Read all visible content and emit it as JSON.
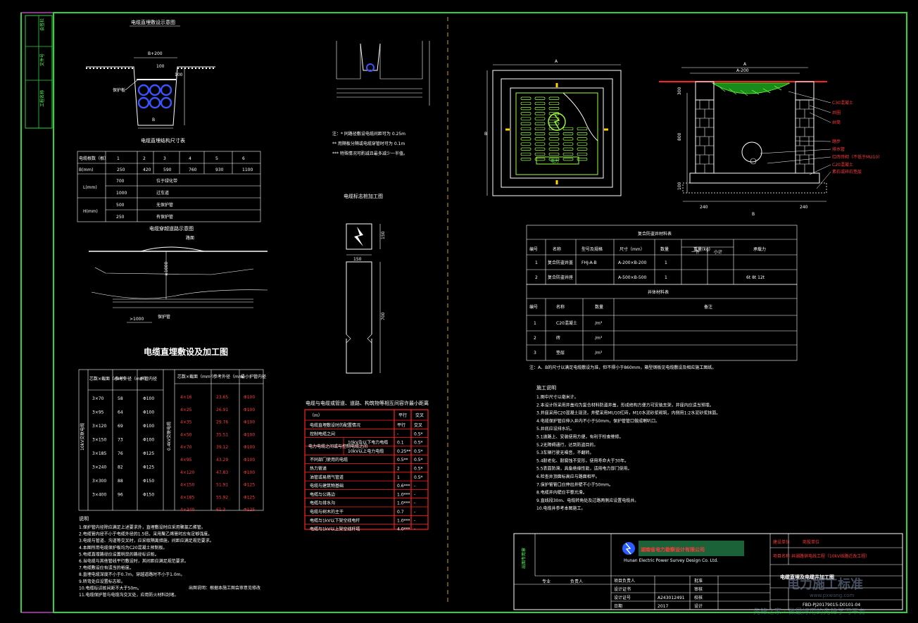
{
  "sidebar": {
    "labels": [
      "会签栏",
      "文件号",
      "工程名称"
    ]
  },
  "left": {
    "cross_section_title": "电缆直埋敷设示意图",
    "trench_dim_top": "B+200",
    "trench_dim_bottom": "B",
    "dim_100a": "100",
    "dim_100b": "100",
    "protect_label": "保护板",
    "dims_table_title": "电缆直埋结构尺寸表",
    "dims_table": {
      "header": [
        "电缆根数（根）",
        "1",
        "2",
        "3",
        "4",
        "5",
        "6"
      ],
      "b_row": [
        "B(mm)",
        "250",
        "420",
        "590",
        "760",
        "930",
        "1100"
      ],
      "l_label": "L(mm)",
      "l_rows": [
        [
          "700",
          "位于绿化带"
        ],
        [
          "1000",
          "过车道"
        ]
      ],
      "h_label": "H(mm)",
      "h_rows": [
        [
          "500",
          "无保护管"
        ],
        [
          "250",
          "有保护管"
        ]
      ]
    },
    "crossing_title": "电缆穿越道路示意图",
    "crossing_labels": {
      "road": "路面",
      "depth": "≥1000",
      "pipe": "保护管",
      "ext": ">1000"
    },
    "section_title": "电缆直埋敷设及加工图",
    "pipe_table": {
      "headers_left": [
        "芯数×截面（mm²）",
        "参考外径（mm）",
        "护管内径"
      ],
      "headers_right": [
        "芯数×截面（mm²）",
        "参考外径（mm）",
        "最小护管内径"
      ],
      "vlabel_left": "10kV交联电缆",
      "vlabel_right": "0.4kV交联电缆",
      "rows_left": [
        [
          "3×70",
          "58",
          "Φ100"
        ],
        [
          "3×95",
          "64",
          "Φ100"
        ],
        [
          "3×120",
          "69",
          "Φ100"
        ],
        [
          "3×150",
          "73",
          "Φ100"
        ],
        [
          "3×185",
          "76",
          "Φ125"
        ],
        [
          "3×240",
          "82",
          "Φ125"
        ],
        [
          "3×300",
          "88",
          "Φ150"
        ],
        [
          "3×400",
          "96",
          "Φ150"
        ]
      ],
      "rows_right": [
        [
          "4×16",
          "23.65",
          "Φ100"
        ],
        [
          "4×25",
          "26.91",
          "Φ100"
        ],
        [
          "4×35",
          "29.76",
          "Φ100"
        ],
        [
          "4×50",
          "35.51",
          "Φ100"
        ],
        [
          "4×70",
          "39.12",
          "Φ100"
        ],
        [
          "4×95",
          "43.29",
          "Φ100"
        ],
        [
          "4×120",
          "47.83",
          "Φ100"
        ],
        [
          "4×150",
          "51.91",
          "Φ125"
        ],
        [
          "4×185",
          "55.92",
          "Φ125"
        ],
        [
          "4×240",
          "61.3",
          "Φ125"
        ]
      ]
    },
    "notes_title": "说明",
    "notes": [
      "1.保护管内径除应满足上述要求外，直埋敷设时应采用聚氯乙烯管。",
      "2.电缆管内径不小于电缆外径的1.5倍，采用聚乙烯管时应有足够强度。",
      "3.电缆与管道、沟道等交叉时，应采取隔离措施，间距应满足规范要求。",
      "4.本图所用电缆保护板均为C20混凝土预制板。",
      "5.电缆直埋路径应设置明显的路径标识桩。",
      "6.当电缆与其他管线平行敷设时，其间距应满足规范要求。",
      "7.电缆敷设应有适当的裕度。",
      "8.直埋电缆深度不小于0.7m，穿越道路时不小于1.0m。",
      "9.转弯处应设置标志桩。",
      "10.电缆标识桩间距不大于50m。",
      "11.电缆保护管与电缆沟交叉处，应用防火材料封堵。"
    ],
    "footer_banner": "出图说明：根据本施工图会审意见修改"
  },
  "middle": {
    "notes": [
      "注：* 同路径敷设电缆间距可为 0.25m",
      "** 用隔板分隔或电缆穿管时可为 0.1m",
      "*** 特殊情况可酌减且最多减少一半值。"
    ],
    "marker_title": "电缆标志桩加工图",
    "dim_150": "150",
    "dim_700": "700",
    "table_title": "电缆与电缆或管道、道路、构筑物等相互间容许最小距离",
    "table_headers": [
      "（m）",
      "平行",
      "交叉"
    ],
    "rows": [
      [
        "电缆直埋敷设时的配置情况",
        "平行",
        "交叉"
      ],
      [
        "控制电缆之间",
        "-",
        "0.5*"
      ],
      [
        "10kV及以下电力电缆",
        "0.1",
        "0.5*"
      ],
      [
        "10kV以上电力电缆",
        "0.25**",
        "0.5*"
      ],
      [
        "不同部门使用的电缆",
        "0.5**",
        "0.5*"
      ],
      [
        "热力管道",
        "2",
        "0.5*"
      ],
      [
        "油管或易燃气管道",
        "1",
        "0.5*"
      ],
      [
        "电缆与建筑物基础",
        "0.6***",
        "-"
      ],
      [
        "电缆与公路边",
        "1.0***",
        "-"
      ],
      [
        "电缆与排水沟",
        "1.0***",
        "-"
      ],
      [
        "电缆与树木的主干",
        "0.7",
        "-"
      ],
      [
        "电缆与1kV以下架空线电杆",
        "1.0***",
        "-"
      ],
      [
        "电缆与1kV以上架空线杆塔",
        "4.0***",
        "-"
      ]
    ],
    "row_group_label": "电力电缆之间或与控制电缆之间"
  },
  "right": {
    "plan_dim_a": "A",
    "plan_dim_b": "B",
    "plan_cover_text": "电力",
    "elev_dims": {
      "a": "A",
      "a2": "A-200",
      "h1": "300",
      "h2": "800",
      "h3": "100",
      "b": "B",
      "w1": "240",
      "w2": "240"
    },
    "elev_labels": [
      "C30混凝土",
      "井圈",
      "井筒",
      "踏步",
      "排水管",
      "红砖砖砌（不低于MU10）",
      "C20混凝土",
      "素石或碎石垫层"
    ],
    "material_table": {
      "title": "复合防盗井材料表",
      "headers": [
        "编号",
        "名称",
        "型号及规格",
        "尺寸（mm）",
        "数量",
        "重量(kg)",
        "承载力"
      ],
      "sub_headers": [
        "一件",
        "小计"
      ],
      "rows": [
        [
          "1",
          "复合防盗井盖",
          "FHJ-A-B",
          "A-200×B-200",
          "1",
          "",
          ""
        ],
        [
          "2",
          "复合防盗井座",
          "",
          "A-500×B-500",
          "1",
          "",
          "6t  8t  12t"
        ]
      ]
    },
    "well_table": {
      "title": "井体材料表",
      "headers": [
        "编号",
        "名称",
        "数量",
        "备注"
      ],
      "rows": [
        [
          "1",
          "C20混凝土",
          "/m³",
          ""
        ],
        [
          "2",
          "砖",
          "/m³",
          ""
        ],
        [
          "3",
          "垫层",
          "/m³",
          ""
        ]
      ]
    },
    "well_note": "注：A、B的尺寸以满足电缆敷设为准，但不得小于860mm，箱型钢板见电缆敷设及相应施工图纸。",
    "construction_title": "施工说明",
    "construction": [
      "1.图中尺寸以毫米计。",
      "2.本设计所采用井盖均为复合材料防盗井盖，形成结构方便方可安装支架，井座内应适当预埋。",
      "3.井座采用C20混凝土现浇，井壁采用MU10红砖，M10水泥砂浆砌筑，内侧用1:2水泥砂浆抹面。",
      "4.电缆保护管应伸入井内不小于50mm，保护管管口做成喇叭口。",
      "5.井底应设排水坑。",
      "5.1道路上、安装使用方便，有利于检查维修。",
      "5.2无障碍通行，达到防盗目的。",
      "5.3车辆行驶无噪音，不翻转。",
      "5.4耐老化、耐腐蚀不变形，使用寿命大于30年。",
      "5.5表面防滑，具备绝缘性能，适用电力部门使用。",
      "6.检查井顶面标高应与路面相平。",
      "7.保护管管口应伸出井壁不小于50mm。",
      "8.电缆井内壁应平整光滑。",
      "9.直线段30m、电缆转角处及过路两侧应设置电缆井。",
      "10.电缆井参考本图施工。"
    ]
  },
  "title_block": {
    "stamp": "出图专用章",
    "company": "湖南省电力勘察设计有限公司",
    "company_en": "Hunan Electric Power Survey Design Co. Ltd.",
    "builder_label": "建设单位",
    "builder_value": "商投单位",
    "project_label": "项目名称",
    "project_value": "井湖路供电线工程（10kV线路迁改工程）",
    "drawing_title": "电缆直埋及电缆井加工图",
    "drawing_no": "FBD-PJ20179015-D0101-04",
    "rows": [
      [
        "项目负责人",
        "",
        "批准",
        ""
      ],
      [
        "设计证书",
        "",
        "审核",
        ""
      ],
      [
        "设计证号",
        "A243012491",
        "校核",
        ""
      ],
      [
        "日期",
        "2017",
        "设计",
        ""
      ]
    ],
    "bottom_labels": [
      "专业",
      "负责人"
    ]
  },
  "watermark": {
    "site": "电力施工标准",
    "url": "www.pxwang.com",
    "sub": "先锋之家 · 做最好用的先锋学习平台"
  }
}
